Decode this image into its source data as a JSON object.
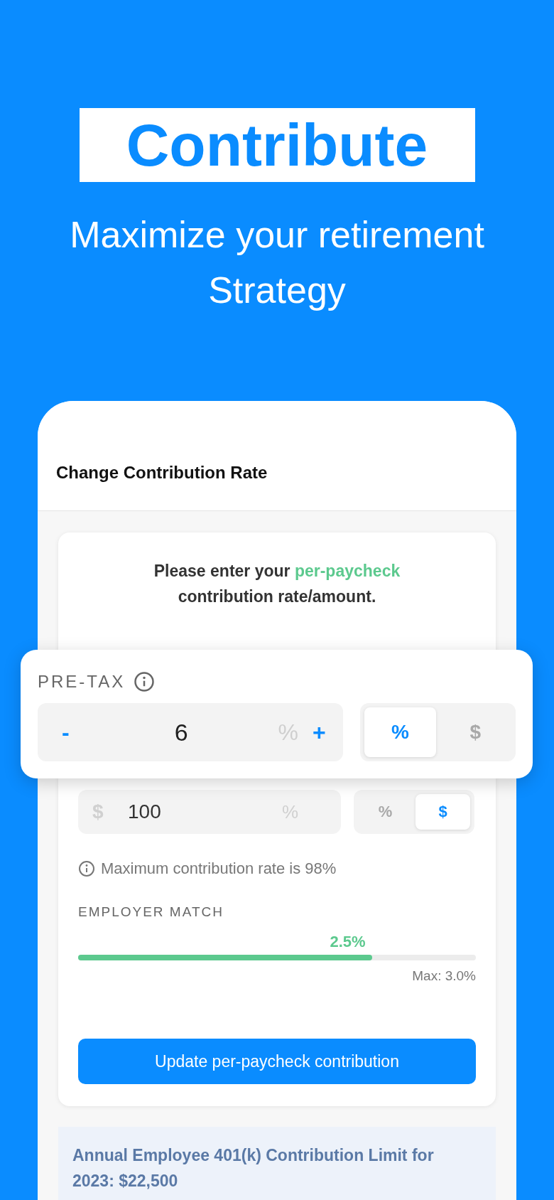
{
  "hero": {
    "title": "Contribute",
    "subtitle": [
      "Maximize your retirement",
      "Strategy"
    ]
  },
  "screen": {
    "title": "Change Contribution Rate",
    "prompt": {
      "before": "Please enter your",
      "highlight": "per-paycheck",
      "after": "contribution rate/amount."
    },
    "pretax": {
      "label": "PRE-TAX",
      "decrement": "-",
      "value": "6",
      "unit": "%",
      "increment": "+",
      "modes": [
        {
          "label": "%",
          "selected": true
        },
        {
          "label": "$",
          "selected": false
        }
      ]
    },
    "roth": {
      "prefix": "$",
      "value": "100",
      "unit": "%",
      "modes": [
        {
          "label": "%",
          "selected": false
        },
        {
          "label": "$",
          "selected": true
        }
      ]
    },
    "note": "Maximum contribution rate is 98%",
    "employer_match": {
      "label": "EMPLOYER MATCH",
      "reading": "2.5%",
      "level": 0.74,
      "max": "Max: 3.0%"
    },
    "button": "Update per-paycheck contribution",
    "limit": "Annual Employee 401(k) Contribution Limit for 2023: $22,500"
  }
}
